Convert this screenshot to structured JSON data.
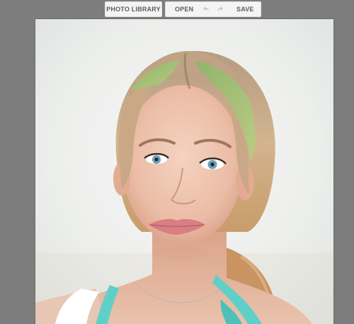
{
  "toolbar": {
    "photo_library_label": "PHOTO LIBRARY",
    "open_label": "OPEN",
    "save_label": "SAVE",
    "undo_icon": "undo-icon",
    "redo_icon": "redo-icon"
  },
  "canvas": {
    "subject": "portrait-photo",
    "background_color": "#eef0ef",
    "accent_colors": {
      "hair_highlight": "#8fbf6a",
      "necklace": "#5fd0c8",
      "lips": "#d97e84"
    }
  },
  "colors": {
    "app_background": "#7d7d7d",
    "button_background": "#f4f4f4",
    "button_text": "#5c5c5c"
  }
}
